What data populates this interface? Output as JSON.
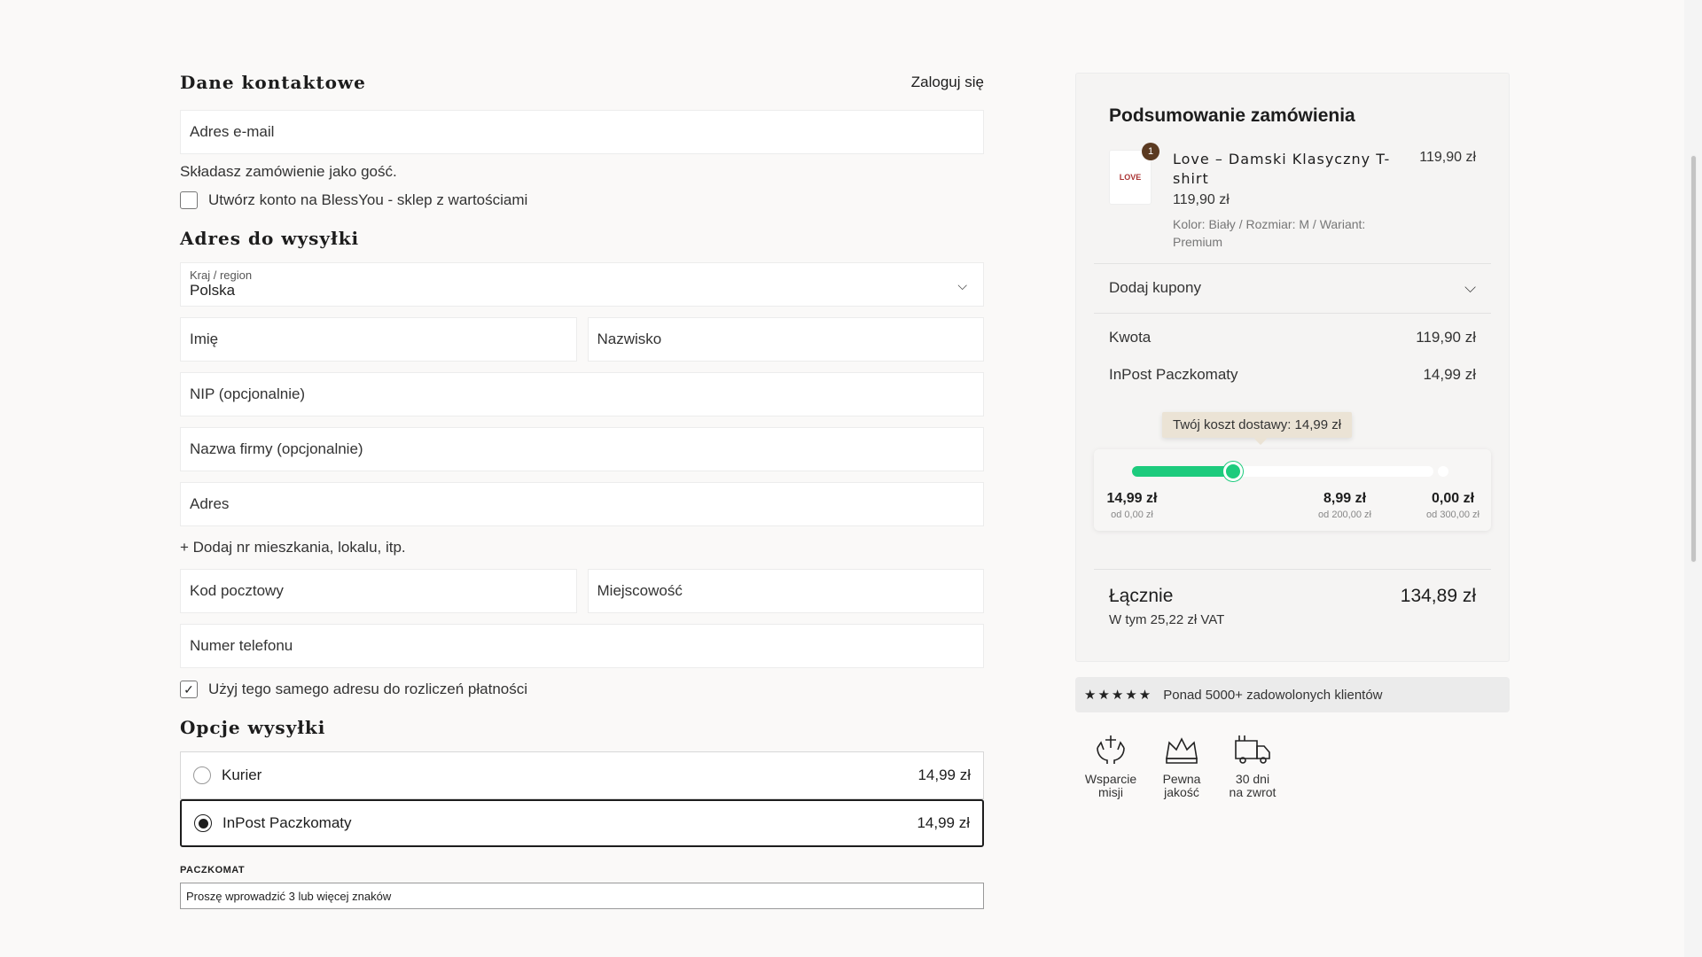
{
  "contact": {
    "title": "Dane kontaktowe",
    "login": "Zaloguj się",
    "email_placeholder": "Adres e-mail",
    "guest_note": "Składasz zamówienie jako gość.",
    "create_account": "Utwórz konto na BlessYou - sklep z wartościami"
  },
  "shipping_address": {
    "title": "Adres do wysyłki",
    "country_label": "Kraj / region",
    "country_value": "Polska",
    "first_name": "Imię",
    "last_name": "Nazwisko",
    "nip": "NIP (opcjonalnie)",
    "company": "Nazwa firmy (opcjonalnie)",
    "address": "Adres",
    "add_apartment": "+ Dodaj nr mieszkania, lokalu, itp.",
    "postal_code": "Kod pocztowy",
    "city": "Miejscowość",
    "phone": "Numer telefonu",
    "same_billing": "Użyj tego samego adresu do rozliczeń płatności"
  },
  "shipping_options": {
    "title": "Opcje wysyłki",
    "options": [
      {
        "label": "Kurier",
        "price": "14,99 zł",
        "selected": false
      },
      {
        "label": "InPost Paczkomaty",
        "price": "14,99 zł",
        "selected": true
      }
    ],
    "paczkomat_label": "PACZKOMAT",
    "paczkomat_placeholder": "Proszę wprowadzić 3 lub więcej znaków"
  },
  "summary": {
    "title": "Podsumowanie zamówienia",
    "product": {
      "qty": "1",
      "thumb_text": "LOVE",
      "name": "Love – Damski Klasyczny T-shirt",
      "price": "119,90 zł",
      "unit_price": "119,90 zł",
      "variant": "Kolor: Biały / Rozmiar: M / Wariant: Premium"
    },
    "coupons": "Dodaj kupony",
    "subtotal_label": "Kwota",
    "subtotal_value": "119,90 zł",
    "shipping_label": "InPost Paczkomaty",
    "shipping_value": "14,99 zł",
    "tooltip": "Twój koszt dostawy: 14,99 zł",
    "progress_fraction": 0.3,
    "tiers": [
      {
        "price": "14,99 zł",
        "from": "od 0,00 zł"
      },
      {
        "price": "8,99 zł",
        "from": "od 200,00 zł"
      },
      {
        "price": "0,00 zł",
        "from": "od 300,00 zł"
      }
    ],
    "total_label": "Łącznie",
    "total_value": "134,89 zł",
    "vat": "W tym 25,22 zł VAT"
  },
  "rating": {
    "stars": "★★★★★",
    "text": "Ponad 5000+ zadowolonych klientów"
  },
  "badges": [
    {
      "icon": "hands-cross-icon",
      "line1": "Wsparcie",
      "line2": "misji"
    },
    {
      "icon": "quality-crown-icon",
      "line1": "Pewna",
      "line2": "jakość"
    },
    {
      "icon": "delivery-truck-icon",
      "line1": "30 dni",
      "line2": "na zwrot"
    }
  ],
  "colors": {
    "accent": "#1dcb7d",
    "qty_badge": "#5b3a21",
    "tooltip": "#ebe3d5"
  }
}
